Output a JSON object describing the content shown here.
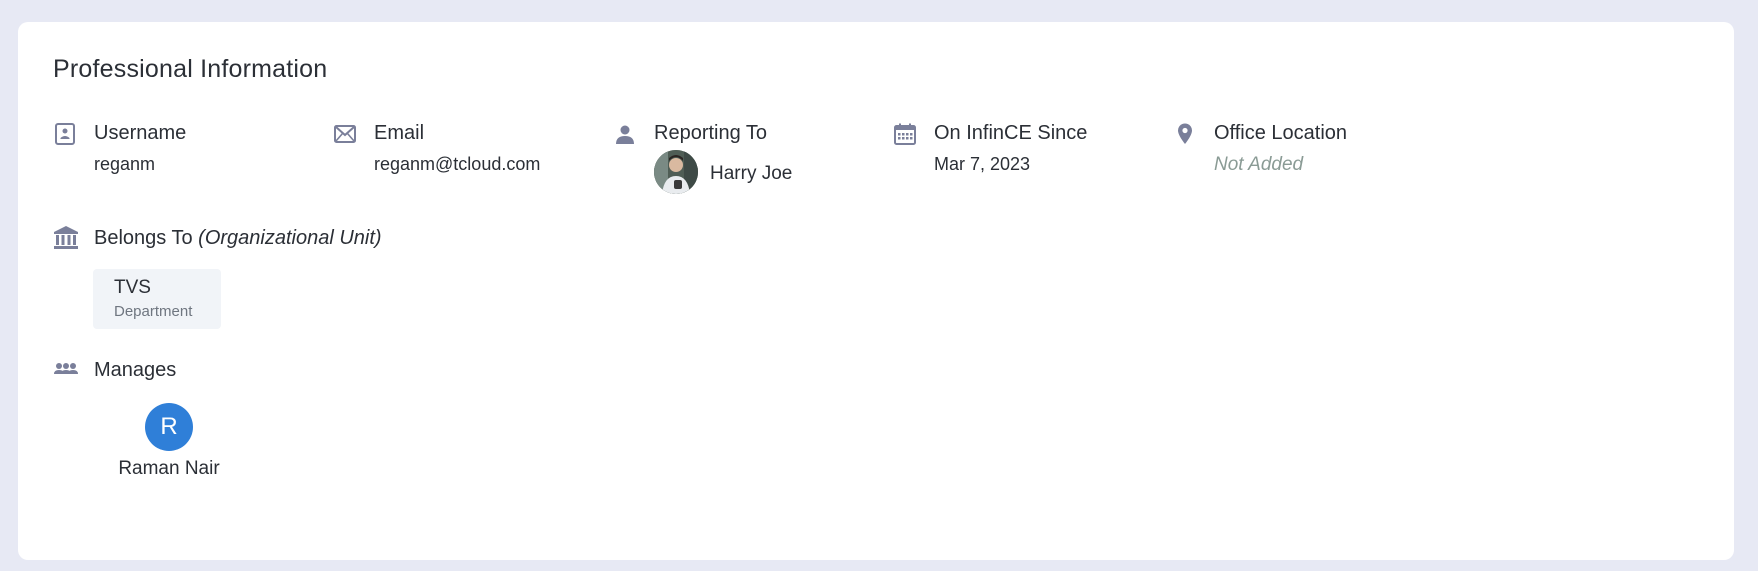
{
  "section": {
    "title": "Professional Information"
  },
  "fields": {
    "username": {
      "label": "Username",
      "value": "reganm",
      "icon": "id-card-icon"
    },
    "email": {
      "label": "Email",
      "value": "reganm@tcloud.com",
      "icon": "envelope-icon"
    },
    "reporting_to": {
      "label": "Reporting To",
      "value": "Harry Joe",
      "icon": "person-icon"
    },
    "on_since": {
      "label": "On InfinCE Since",
      "value": "Mar 7, 2023",
      "icon": "calendar-icon"
    },
    "office_location": {
      "label": "Office Location",
      "value": "Not Added",
      "icon": "location-pin-icon"
    }
  },
  "belongs_to": {
    "label": "Belongs To",
    "label_suffix": "(Organizational Unit)",
    "icon": "institution-icon",
    "units": [
      {
        "name": "TVS",
        "type": "Department"
      }
    ]
  },
  "manages": {
    "label": "Manages",
    "icon": "group-icon",
    "reports": [
      {
        "initial": "R",
        "name": "Raman Nair",
        "avatar_color": "#2f7fd8"
      }
    ]
  },
  "colors": {
    "page_bg": "#e7e9f4",
    "card_bg": "#ffffff",
    "icon": "#7a7f9a",
    "muted": "#8a9b95",
    "chip_bg": "#f1f4f8",
    "avatar_blue": "#2f7fd8"
  }
}
